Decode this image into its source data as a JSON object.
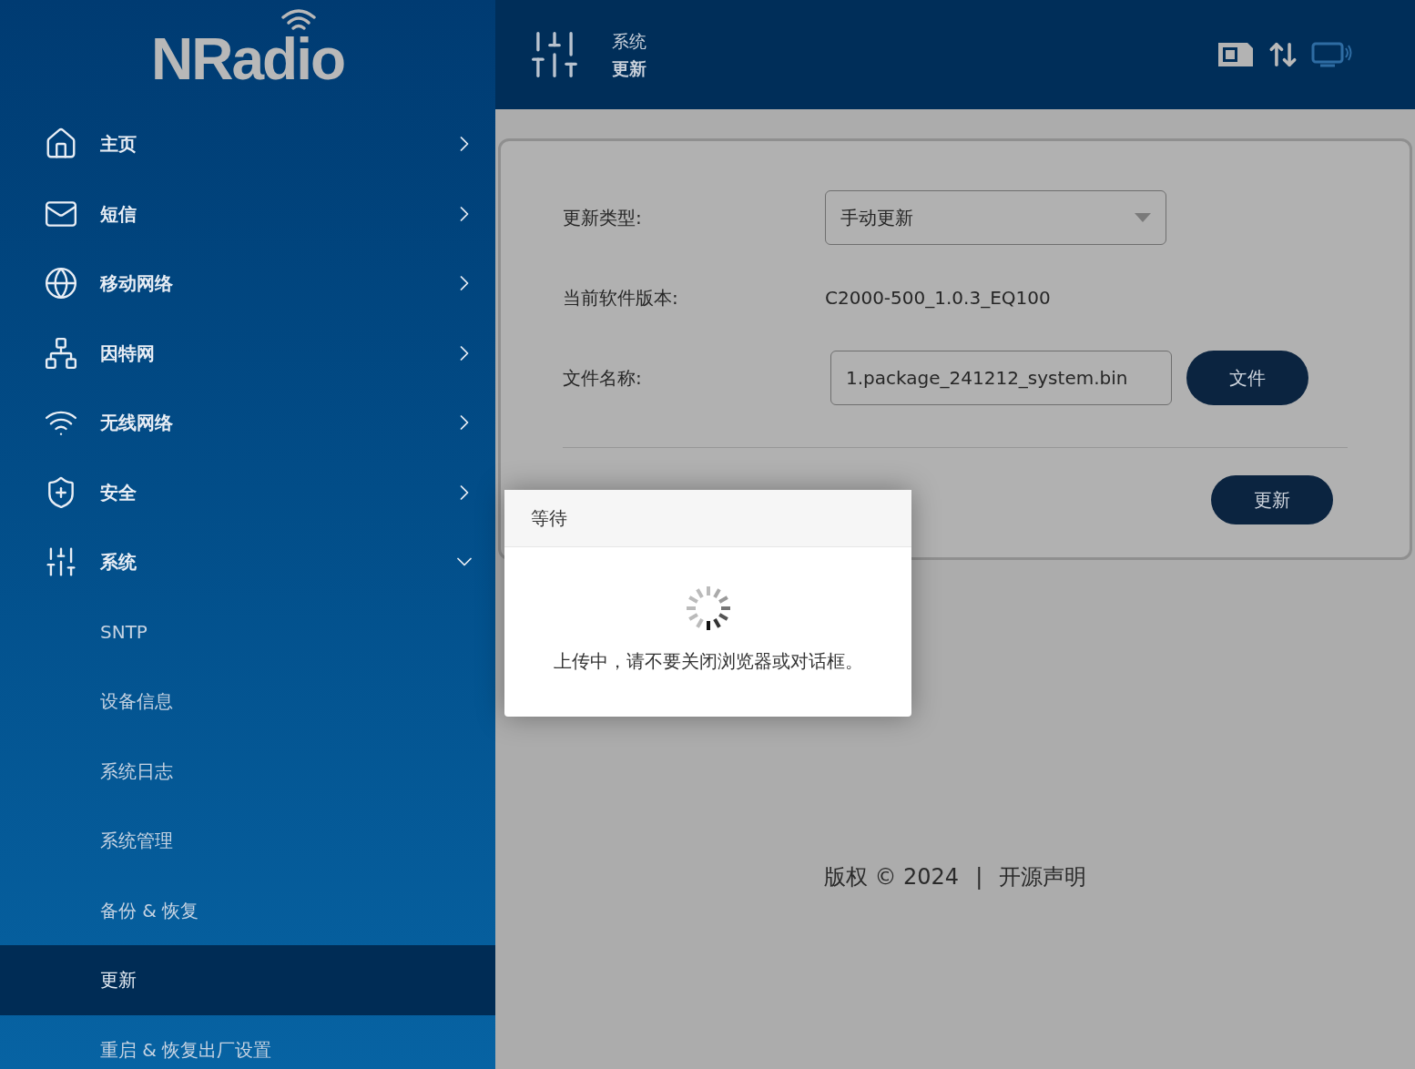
{
  "logo": {
    "text": "NRadio"
  },
  "sidebar": {
    "items": [
      {
        "label": "主页",
        "expanded": false
      },
      {
        "label": "短信",
        "expanded": false
      },
      {
        "label": "移动网络",
        "expanded": false
      },
      {
        "label": "因特网",
        "expanded": false
      },
      {
        "label": "无线网络",
        "expanded": false
      },
      {
        "label": "安全",
        "expanded": false
      },
      {
        "label": "系统",
        "expanded": true,
        "children": [
          {
            "label": "SNTP",
            "selected": false
          },
          {
            "label": "设备信息",
            "selected": false
          },
          {
            "label": "系统日志",
            "selected": false
          },
          {
            "label": "系统管理",
            "selected": false
          },
          {
            "label": "备份 & 恢复",
            "selected": false
          },
          {
            "label": "更新",
            "selected": true
          },
          {
            "label": "重启 & 恢复出厂设置",
            "selected": false
          }
        ]
      }
    ]
  },
  "header": {
    "section": "系统",
    "page": "更新"
  },
  "form": {
    "rows": [
      {
        "kind": "select",
        "label": "更新类型:",
        "value": "手动更新"
      },
      {
        "kind": "text",
        "label": "当前软件版本:",
        "value": "C2000-500_1.0.3_EQ100"
      },
      {
        "kind": "file",
        "label": "文件名称:",
        "value": "1.package_241212_system.bin",
        "button": "文件"
      }
    ],
    "submit": "更新"
  },
  "dialog": {
    "title": "等待",
    "message": "上传中，请不要关闭浏览器或对话框。"
  },
  "footer": {
    "copyright": "版权 © 2024",
    "separator": "|",
    "link": "开源声明"
  }
}
